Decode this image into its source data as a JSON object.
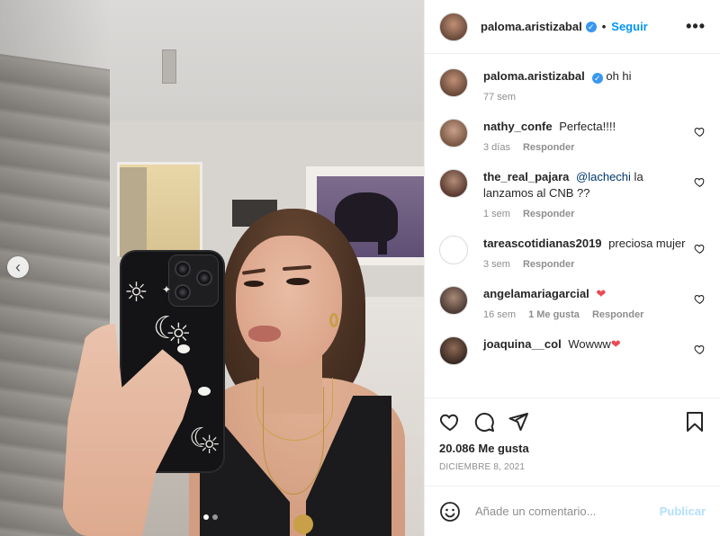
{
  "post": {
    "author": "paloma.aristizabal",
    "follow_label": "Seguir",
    "separator": "•",
    "more_label": "•••",
    "caption": "oh hi",
    "caption_time": "77 sem",
    "likes": "20.086 Me gusta",
    "date": "DICIEMBRE 8, 2021",
    "carousel": {
      "current": 1,
      "total": 2
    }
  },
  "comments": [
    {
      "user": "nathy_confe",
      "text": "Perfecta!!!!",
      "time": "3 días",
      "reply": "Responder"
    },
    {
      "user": "the_real_pajara",
      "mention": "@lachechi",
      "text": " la lanzamos al CNB ??",
      "time": "1 sem",
      "reply": "Responder"
    },
    {
      "user": "tareascotidianas2019",
      "text": "preciosa mujer",
      "time": "3 sem",
      "reply": "Responder"
    },
    {
      "user": "angelamariagarcial",
      "text": "",
      "emoji": "❤",
      "time": "16 sem",
      "likes": "1 Me gusta",
      "reply": "Responder"
    },
    {
      "user": "joaquina__col",
      "text": "Wowww",
      "emoji": "❤"
    }
  ],
  "add_comment": {
    "placeholder": "Añade un comentario...",
    "publish_label": "Publicar"
  },
  "icons": {
    "verified": "✓",
    "nav_prev": "‹"
  },
  "colors": {
    "accent": "#0095f6",
    "heart": "#ed4956",
    "verified": "#3897f0",
    "publish_disabled": "#b2dffc"
  }
}
